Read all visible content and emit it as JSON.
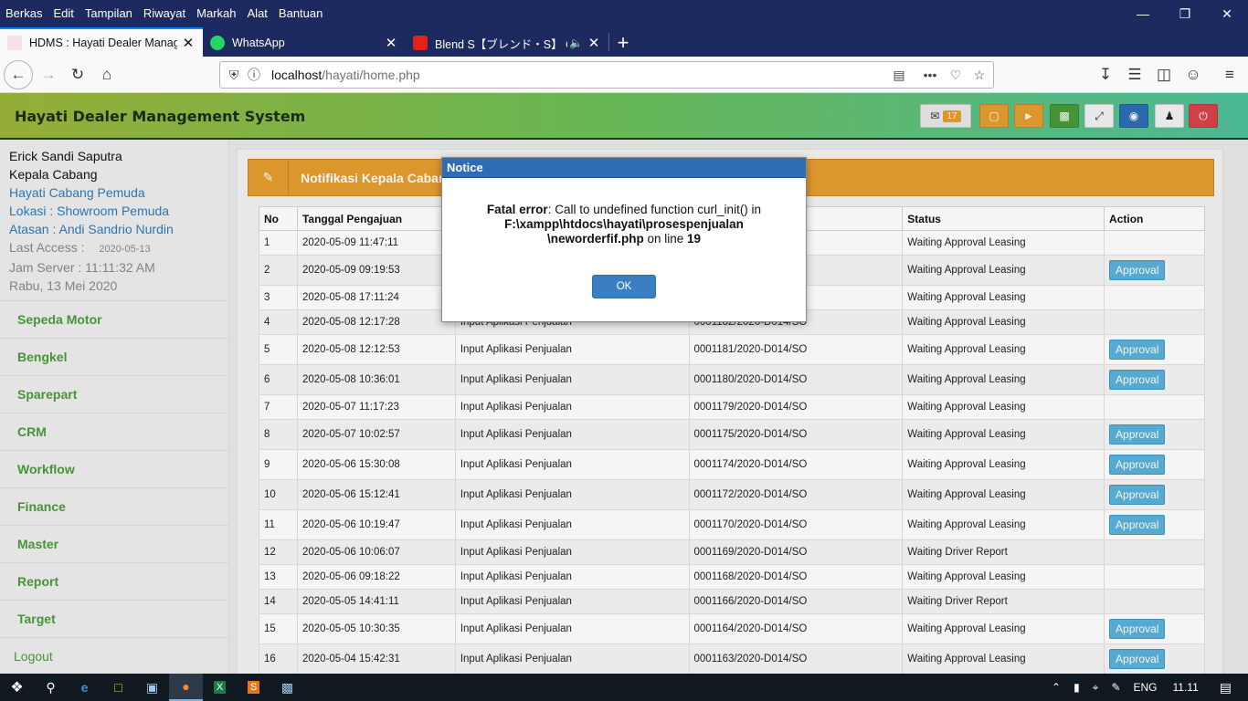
{
  "browser": {
    "menu": [
      "Berkas",
      "Edit",
      "Tampilan",
      "Riwayat",
      "Markah",
      "Alat",
      "Bantuan"
    ],
    "window_controls": {
      "minimize": "—",
      "restore": "❐",
      "close": "✕"
    },
    "tabs": [
      {
        "title": "HDMS : Hayati Dealer Managem",
        "close": "✕"
      },
      {
        "title": "WhatsApp",
        "close": "✕"
      },
      {
        "title": "Blend S【ブレンド・S】 Op",
        "close": "✕"
      }
    ],
    "new_tab": "+",
    "url_host": "localhost",
    "url_path": "/hayati/home.php"
  },
  "app": {
    "title": "Hayati Dealer Management System",
    "mail_count": "17"
  },
  "user": {
    "name": "Erick Sandi Saputra",
    "role": "Kepala Cabang",
    "branch": "Hayati Cabang Pemuda",
    "location": "Lokasi : Showroom Pemuda",
    "supervisor": "Atasan : Andi Sandrio Nurdin",
    "last_access_label": "Last Access :",
    "last_access": "2020-05-13",
    "server_time": "Jam Server : 11:11:32 AM",
    "date": "Rabu, 13 Mei 2020"
  },
  "sidebar": {
    "items": [
      "Sepeda Motor",
      "Bengkel",
      "Sparepart",
      "CRM",
      "Workflow",
      "Finance",
      "Master",
      "Report",
      "Target"
    ],
    "logout": "Logout"
  },
  "panel": {
    "title": "Notifikasi Kepala Cabang"
  },
  "table": {
    "headers": [
      "No",
      "Tanggal Pengajuan",
      "",
      "",
      "Status",
      "Action"
    ],
    "rows": [
      {
        "no": "1",
        "date": "2020-05-09 11:47:11",
        "type": "",
        "code": "",
        "status": "Waiting Approval Leasing",
        "action": ""
      },
      {
        "no": "2",
        "date": "2020-05-09 09:19:53",
        "type": "",
        "code": "",
        "status": "Waiting Approval Leasing",
        "action": "Approval"
      },
      {
        "no": "3",
        "date": "2020-05-08 17:11:24",
        "type": "",
        "code": "",
        "status": "Waiting Approval Leasing",
        "action": ""
      },
      {
        "no": "4",
        "date": "2020-05-08 12:17:28",
        "type": "Input Aplikasi Penjualan",
        "code": "0001182/2020-D014/SO",
        "status": "Waiting Approval Leasing",
        "action": ""
      },
      {
        "no": "5",
        "date": "2020-05-08 12:12:53",
        "type": "Input Aplikasi Penjualan",
        "code": "0001181/2020-D014/SO",
        "status": "Waiting Approval Leasing",
        "action": "Approval"
      },
      {
        "no": "6",
        "date": "2020-05-08 10:36:01",
        "type": "Input Aplikasi Penjualan",
        "code": "0001180/2020-D014/SO",
        "status": "Waiting Approval Leasing",
        "action": "Approval"
      },
      {
        "no": "7",
        "date": "2020-05-07 11:17:23",
        "type": "Input Aplikasi Penjualan",
        "code": "0001179/2020-D014/SO",
        "status": "Waiting Approval Leasing",
        "action": ""
      },
      {
        "no": "8",
        "date": "2020-05-07 10:02:57",
        "type": "Input Aplikasi Penjualan",
        "code": "0001175/2020-D014/SO",
        "status": "Waiting Approval Leasing",
        "action": "Approval"
      },
      {
        "no": "9",
        "date": "2020-05-06 15:30:08",
        "type": "Input Aplikasi Penjualan",
        "code": "0001174/2020-D014/SO",
        "status": "Waiting Approval Leasing",
        "action": "Approval"
      },
      {
        "no": "10",
        "date": "2020-05-06 15:12:41",
        "type": "Input Aplikasi Penjualan",
        "code": "0001172/2020-D014/SO",
        "status": "Waiting Approval Leasing",
        "action": "Approval"
      },
      {
        "no": "11",
        "date": "2020-05-06 10:19:47",
        "type": "Input Aplikasi Penjualan",
        "code": "0001170/2020-D014/SO",
        "status": "Waiting Approval Leasing",
        "action": "Approval"
      },
      {
        "no": "12",
        "date": "2020-05-06 10:06:07",
        "type": "Input Aplikasi Penjualan",
        "code": "0001169/2020-D014/SO",
        "status": "Waiting Driver Report",
        "action": ""
      },
      {
        "no": "13",
        "date": "2020-05-06 09:18:22",
        "type": "Input Aplikasi Penjualan",
        "code": "0001168/2020-D014/SO",
        "status": "Waiting Approval Leasing",
        "action": ""
      },
      {
        "no": "14",
        "date": "2020-05-05 14:41:11",
        "type": "Input Aplikasi Penjualan",
        "code": "0001166/2020-D014/SO",
        "status": "Waiting Driver Report",
        "action": ""
      },
      {
        "no": "15",
        "date": "2020-05-05 10:30:35",
        "type": "Input Aplikasi Penjualan",
        "code": "0001164/2020-D014/SO",
        "status": "Waiting Approval Leasing",
        "action": "Approval"
      },
      {
        "no": "16",
        "date": "2020-05-04 15:42:31",
        "type": "Input Aplikasi Penjualan",
        "code": "0001163/2020-D014/SO",
        "status": "Waiting Approval Leasing",
        "action": "Approval"
      }
    ]
  },
  "modal": {
    "title": "Notice",
    "error_label": "Fatal error",
    "message": ": Call to undefined function curl_init() in",
    "path_line1": "F:\\xampp\\htdocs\\hayati\\prosespenjualan",
    "path_line2": "\\neworderfif.php",
    "on_line": " on line ",
    "line_no": "19",
    "ok": "OK"
  },
  "taskbar": {
    "lang": "ENG",
    "time": "11.11"
  }
}
